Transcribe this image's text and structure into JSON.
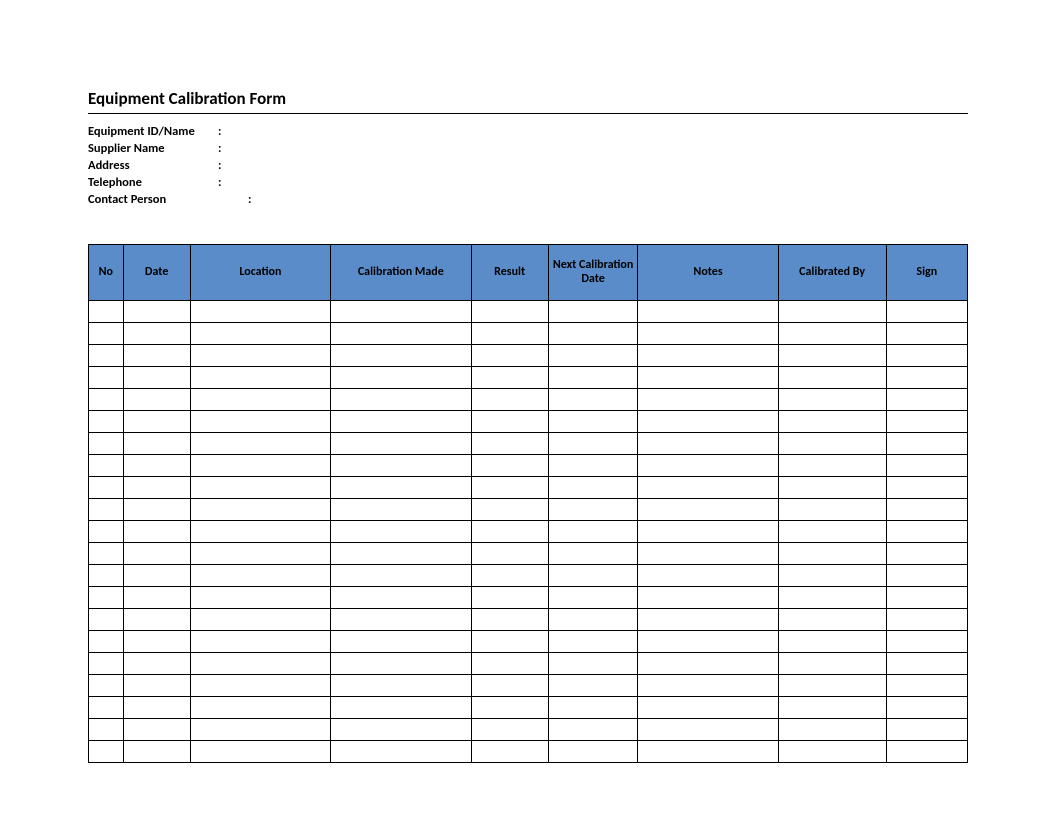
{
  "title": "Equipment Calibration Form",
  "meta": {
    "fields": [
      {
        "label": "Equipment ID/Name",
        "value": "",
        "wide": false
      },
      {
        "label": "Supplier Name",
        "value": "",
        "wide": false
      },
      {
        "label": "Address",
        "value": "",
        "wide": false
      },
      {
        "label": "Telephone",
        "value": "",
        "wide": false
      },
      {
        "label": "Contact Person",
        "value": "",
        "wide": true
      }
    ]
  },
  "table": {
    "headers": [
      "No",
      "Date",
      "Location",
      "Calibration Made",
      "Result",
      "Next Calibration Date",
      "Notes",
      "Calibrated By",
      "Sign"
    ],
    "row_count": 21
  },
  "colors": {
    "header_bg": "#5a8cc9"
  }
}
